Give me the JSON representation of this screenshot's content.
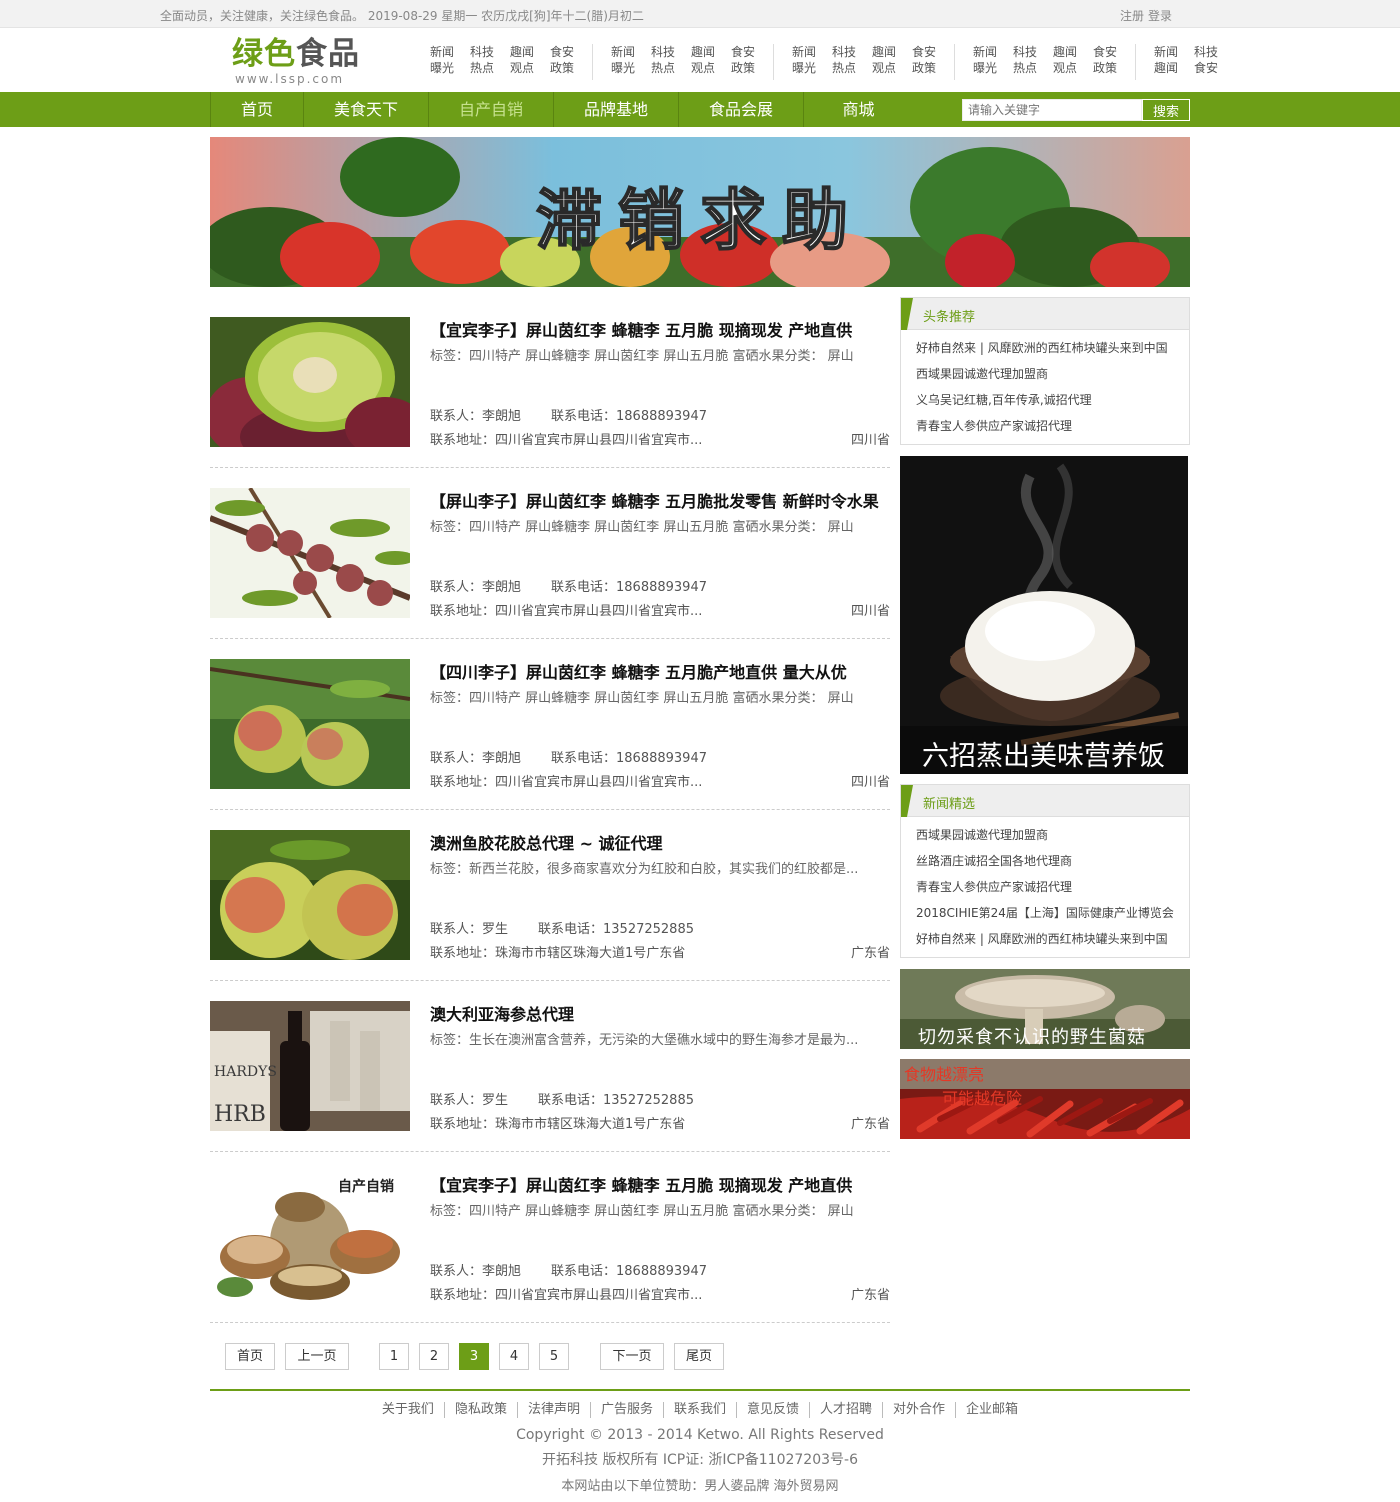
{
  "topbar": {
    "greeting": "全面动员，关注健康，关注绿色食品。 2019-08-29 星期一 农历戊戌[狗]年十二(腊)月初二",
    "register": "注册",
    "login": "登录"
  },
  "logo": {
    "cn_green": "绿色",
    "cn_dark": "食品",
    "en": "www.lssp.com"
  },
  "header_links": [
    [
      [
        "新闻",
        "曝光"
      ],
      [
        "科技",
        "热点"
      ],
      [
        "趣闻",
        "观点"
      ],
      [
        "食安",
        "政策"
      ]
    ],
    [
      [
        "新闻",
        "曝光"
      ],
      [
        "科技",
        "热点"
      ],
      [
        "趣闻",
        "观点"
      ],
      [
        "食安",
        "政策"
      ]
    ],
    [
      [
        "新闻",
        "曝光"
      ],
      [
        "科技",
        "热点"
      ],
      [
        "趣闻",
        "观点"
      ],
      [
        "食安",
        "政策"
      ]
    ],
    [
      [
        "新闻",
        "曝光"
      ],
      [
        "科技",
        "热点"
      ],
      [
        "趣闻",
        "观点"
      ],
      [
        "食安",
        "政策"
      ]
    ],
    [
      [
        "新闻",
        "趣闻"
      ],
      [
        "科技",
        "食安"
      ]
    ]
  ],
  "nav": {
    "items": [
      {
        "label": "首页"
      },
      {
        "label": "美食天下"
      },
      {
        "label": "自产自销",
        "active": true
      },
      {
        "label": "品牌基地"
      },
      {
        "label": "食品会展"
      },
      {
        "label": "商城"
      }
    ],
    "search_placeholder": "请输入关键字",
    "search_button": "搜索"
  },
  "banner": {
    "text": "滞销求助"
  },
  "products": [
    {
      "image": "plum-cut-photo",
      "title": "【宜宾李子】屏山茵红李 蜂糖李 五月脆 现摘现发 产地直供",
      "tags": "标签：四川特产 屏山蜂糖李 屏山茵红李 屏山五月脆 富硒水果分类： 屏山",
      "contact_label": "联系人：李朗旭",
      "phone_label": "联系电话：18688893947",
      "address": "联系地址：四川省宜宾市屏山县四川省宜宾市...",
      "province": "四川省"
    },
    {
      "image": "plum-branch-photo",
      "title": "【屏山李子】屏山茵红李 蜂糖李 五月脆批发零售 新鲜时令水果",
      "tags": "标签：四川特产 屏山蜂糖李 屏山茵红李 屏山五月脆 富硒水果分类： 屏山",
      "contact_label": "联系人：李朗旭",
      "phone_label": "联系电话：18688893947",
      "address": "联系地址：四川省宜宾市屏山县四川省宜宾市...",
      "province": "四川省"
    },
    {
      "image": "plum-pair-photo",
      "title": "【四川李子】屏山茵红李 蜂糖李 五月脆产地直供 量大从优",
      "tags": "标签：四川特产 屏山蜂糖李 屏山茵红李 屏山五月脆 富硒水果分类： 屏山",
      "contact_label": "联系人：李朗旭",
      "phone_label": "联系电话：18688893947",
      "address": "联系地址：四川省宜宾市屏山县四川省宜宾市...",
      "province": "四川省"
    },
    {
      "image": "peach-photo",
      "title": "澳洲鱼胶花胶总代理 ~ 诚征代理",
      "tags": "标签：新西兰花胶，很多商家喜欢分为红胶和白胶，其实我们的红胶都是...",
      "contact_label": "联系人：罗生",
      "phone_label": "联系电话：13527252885",
      "address": "联系地址：珠海市市辖区珠海大道1号广东省",
      "province": "广东省"
    },
    {
      "image": "wine-boxes-photo",
      "title": "澳大利亚海参总代理",
      "tags": "标签：生长在澳洲富含营养，无污染的大堡礁水域中的野生海参才是最为...",
      "contact_label": "联系人：罗生",
      "phone_label": "联系电话：13527252885",
      "address": "联系地址：珠海市市辖区珠海大道1号广东省",
      "province": "广东省"
    },
    {
      "image": "nuts-baskets-photo",
      "image_caption": "自产自销",
      "title": "【宜宾李子】屏山茵红李 蜂糖李 五月脆 现摘现发 产地直供",
      "tags": "标签：四川特产 屏山蜂糖李 屏山茵红李 屏山五月脆 富硒水果分类： 屏山",
      "contact_label": "联系人：李朗旭",
      "phone_label": "联系电话：18688893947",
      "address": "联系地址：四川省宜宾市屏山县四川省宜宾市...",
      "province": "广东省"
    }
  ],
  "pagination": {
    "first": "首页",
    "prev": "上一页",
    "pages": [
      "1",
      "2",
      "3",
      "4",
      "5"
    ],
    "current": "3",
    "next": "下一页",
    "last": "尾页"
  },
  "sidebar": {
    "headline": {
      "title": "头条推荐",
      "items": [
        "好柿自然来 | 风靡欧洲的西红柿块罐头来到中国",
        "西域果园诚邀代理加盟商",
        "义乌吴记红糖,百年传承,诚招代理",
        "青春宝人参供应产家诚招代理"
      ]
    },
    "rice_ad": {
      "caption": "六招蒸出美味营养饭"
    },
    "news": {
      "title": "新闻精选",
      "items": [
        "西域果园诚邀代理加盟商",
        "丝路酒庄诚招全国各地代理商",
        "青春宝人参供应产家诚招代理",
        "2018CIHIE第24届【上海】国际健康产业博览会",
        "好柿自然来 | 风靡欧洲的西红柿块罐头来到中国"
      ]
    },
    "mushroom_ad": {
      "caption": "切勿采食不认识的野生菌菇"
    },
    "chili_ad": {
      "line1": "食物越漂亮",
      "line2": "可能越危险"
    }
  },
  "footer": {
    "links": [
      "关于我们",
      "隐私政策",
      "法律声明",
      "广告服务",
      "联系我们",
      "意见反馈",
      "人才招聘",
      "对外合作",
      "企业邮箱"
    ],
    "copyright": "Copyright © 2013 - 2014 Ketwo. All Rights Reserved",
    "icp": "开拓科技 版权所有 ICP证: 浙ICP备11027203号-6",
    "sponsor": "本网站由以下单位赞助：男人婆品牌 海外贸易网"
  },
  "colors": {
    "brand_green": "#6d9e17",
    "nav_active_text": "#c7e28f"
  }
}
